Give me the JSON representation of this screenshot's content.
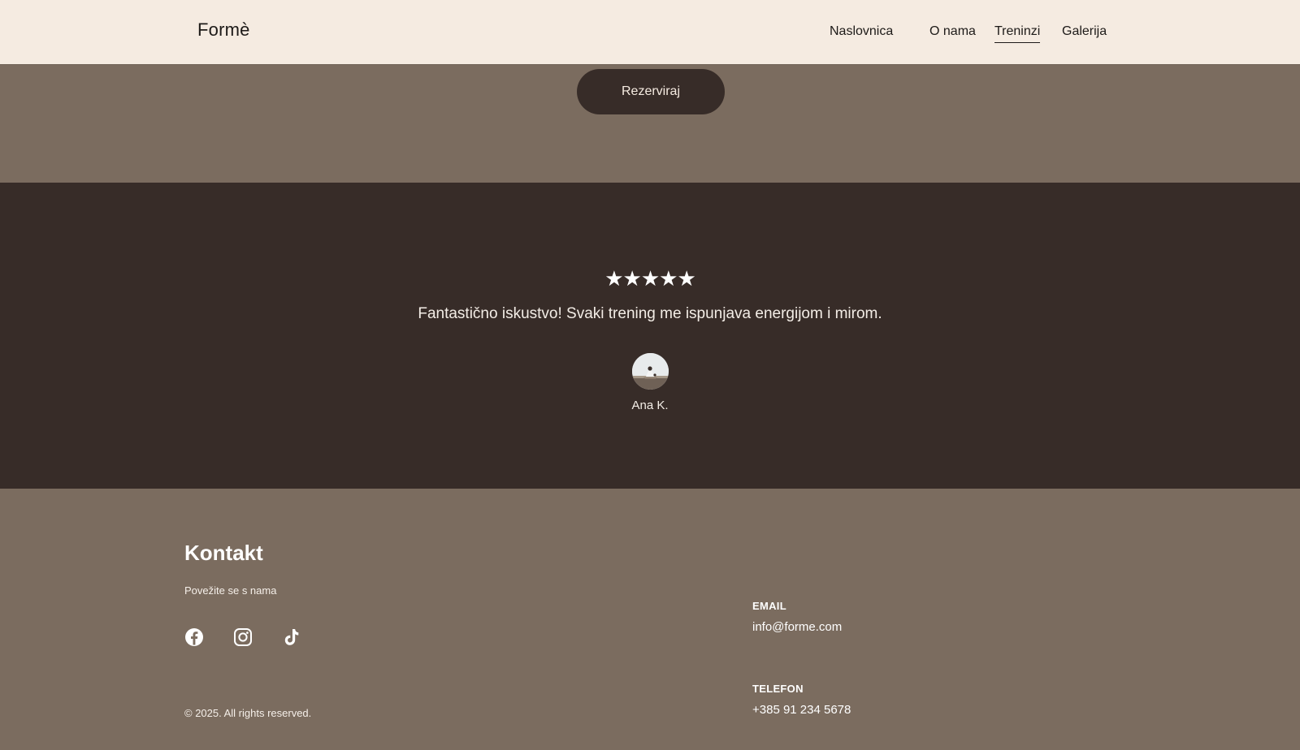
{
  "header": {
    "logo": "Formè",
    "nav": [
      {
        "label": "Naslovnica",
        "active": false
      },
      {
        "label": "O nama",
        "active": false
      },
      {
        "label": "Treninzi",
        "active": true
      },
      {
        "label": "Galerija",
        "active": false
      }
    ]
  },
  "cta": {
    "button_label": "Rezerviraj"
  },
  "testimonial": {
    "rating": 5,
    "stars": "★★★★★",
    "quote": "Fantastično iskustvo! Svaki trening me ispunjava energijom i mirom.",
    "author": "Ana K."
  },
  "footer": {
    "title": "Kontakt",
    "subtitle": "Povežite se s nama",
    "socials": [
      "facebook-icon",
      "instagram-icon",
      "tiktok-icon"
    ],
    "copyright": "© 2025. All rights reserved.",
    "email_label": "EMAIL",
    "email": "info@forme.com",
    "phone_label": "TELEFON",
    "phone": "+385 91 234 5678"
  },
  "colors": {
    "header_bg": "#f5ebe1",
    "band_bg": "#7b6c5f",
    "dark_bg": "#372c28",
    "text_dark": "#1d1a18"
  }
}
